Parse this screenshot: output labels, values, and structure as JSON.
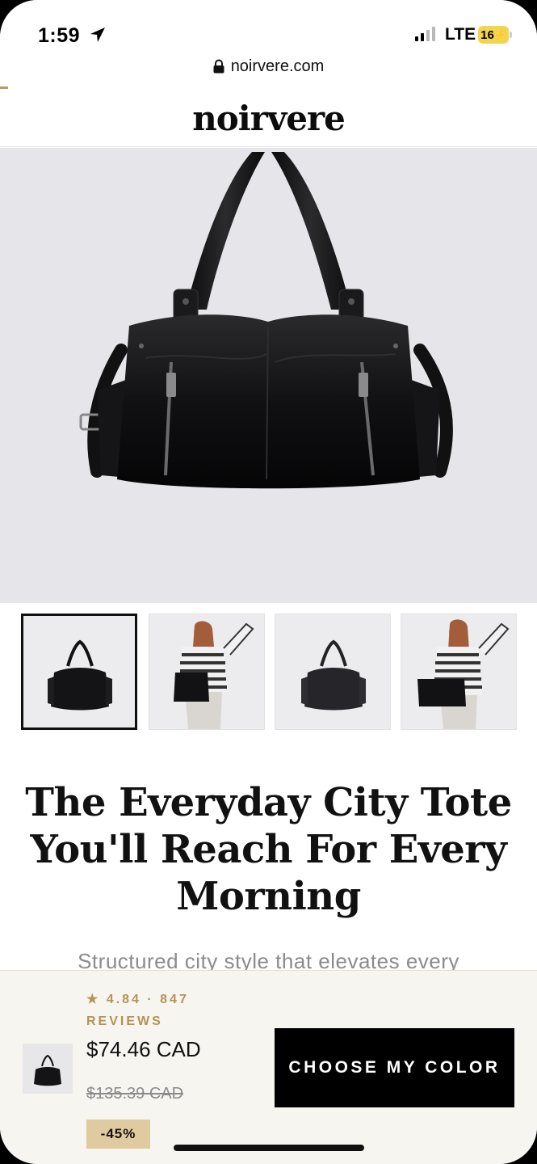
{
  "status_bar": {
    "time": "1:59",
    "network": "LTE",
    "battery": "16"
  },
  "browser": {
    "url": "noirvere.com"
  },
  "site": {
    "logo": "noirvere"
  },
  "gallery": {
    "thumbnails": [
      "bag-front",
      "model-wearing-bag",
      "bag-front",
      "model-wearing-bag"
    ],
    "active_index": 0
  },
  "product": {
    "title": "The Everyday City Tote You'll Reach For Every Morning",
    "subtitle": "Structured city style that elevates every"
  },
  "sticky_bar": {
    "rating_line1": "★ 4.84 · 847",
    "rating_line2": "REVIEWS",
    "price": "$74.46 CAD",
    "compare_price": "$135.39 CAD",
    "discount": "-45%",
    "cta_label": "CHOOSE MY COLOR"
  },
  "colors": {
    "accent_gold": "#b49353",
    "badge_bg": "#dfcb9f",
    "cta_bg": "#000000",
    "hero_bg": "#e6e6ea"
  }
}
